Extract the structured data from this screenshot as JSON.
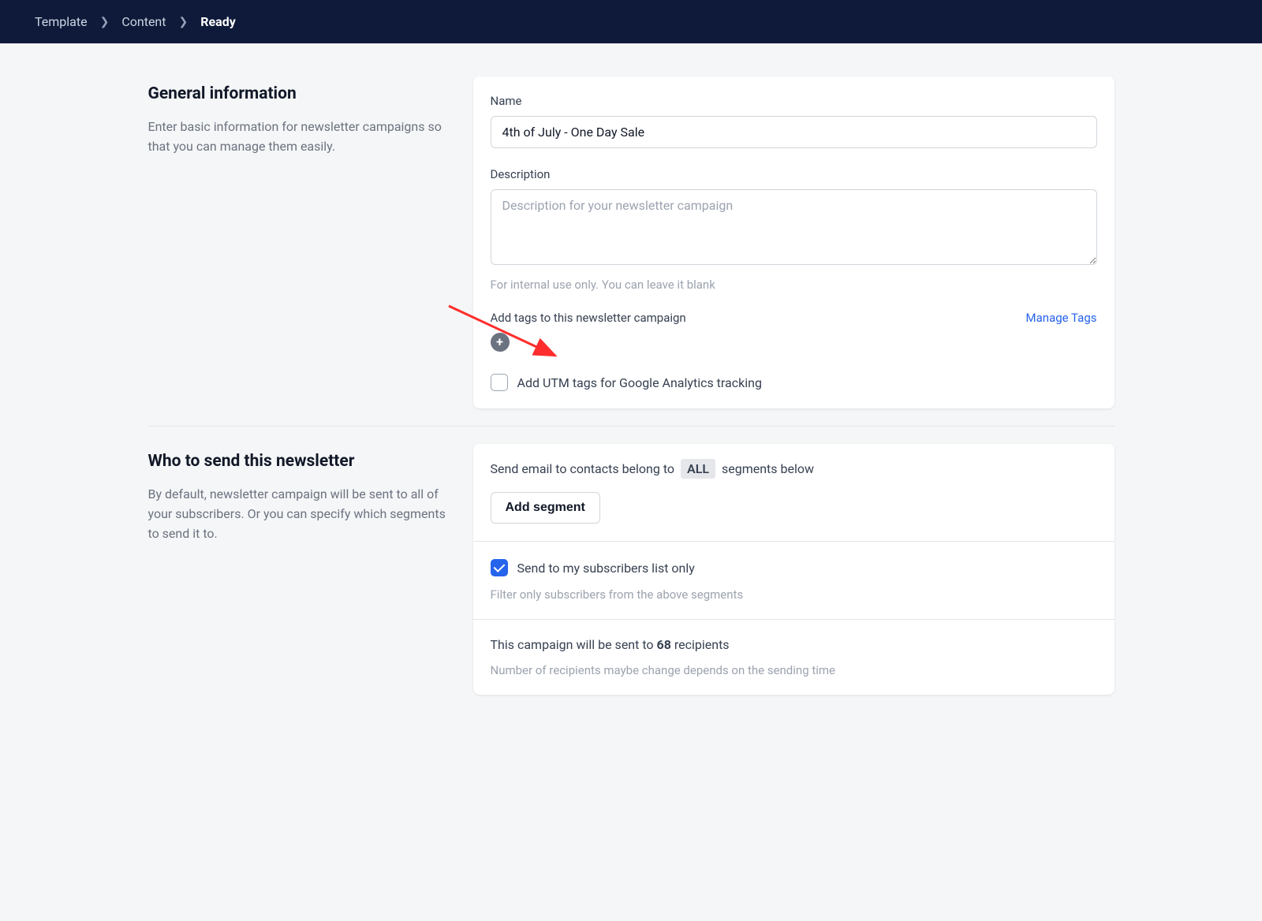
{
  "breadcrumb": {
    "items": [
      {
        "label": "Template",
        "active": false
      },
      {
        "label": "Content",
        "active": false
      },
      {
        "label": "Ready",
        "active": true
      }
    ]
  },
  "sections": {
    "general": {
      "title": "General information",
      "description": "Enter basic information for newsletter campaigns so that you can manage them easily.",
      "fields": {
        "name": {
          "label": "Name",
          "value": "4th of July - One Day Sale"
        },
        "description_field": {
          "label": "Description",
          "placeholder": "Description for your newsletter campaign",
          "hint": "For internal use only. You can leave it blank"
        },
        "tags": {
          "label": "Add tags to this newsletter campaign",
          "manage_link": "Manage Tags"
        },
        "utm": {
          "label": "Add UTM tags for Google Analytics tracking",
          "checked": false
        }
      }
    },
    "recipients": {
      "title": "Who to send this newsletter",
      "description": "By default, newsletter campaign will be sent to all of your subscribers. Or you can specify which segments to send it to.",
      "segment_row": {
        "prefix": "Send email to contacts belong to",
        "pill": "ALL",
        "suffix": "segments below"
      },
      "add_segment_button": "Add segment",
      "subscribers_only": {
        "label": "Send to my subscribers list only",
        "checked": true,
        "hint": "Filter only subscribers from the above segments"
      },
      "summary": {
        "prefix": "This campaign will be sent to",
        "count": "68",
        "suffix": "recipients",
        "hint": "Number of recipients maybe change depends on the sending time"
      }
    }
  }
}
